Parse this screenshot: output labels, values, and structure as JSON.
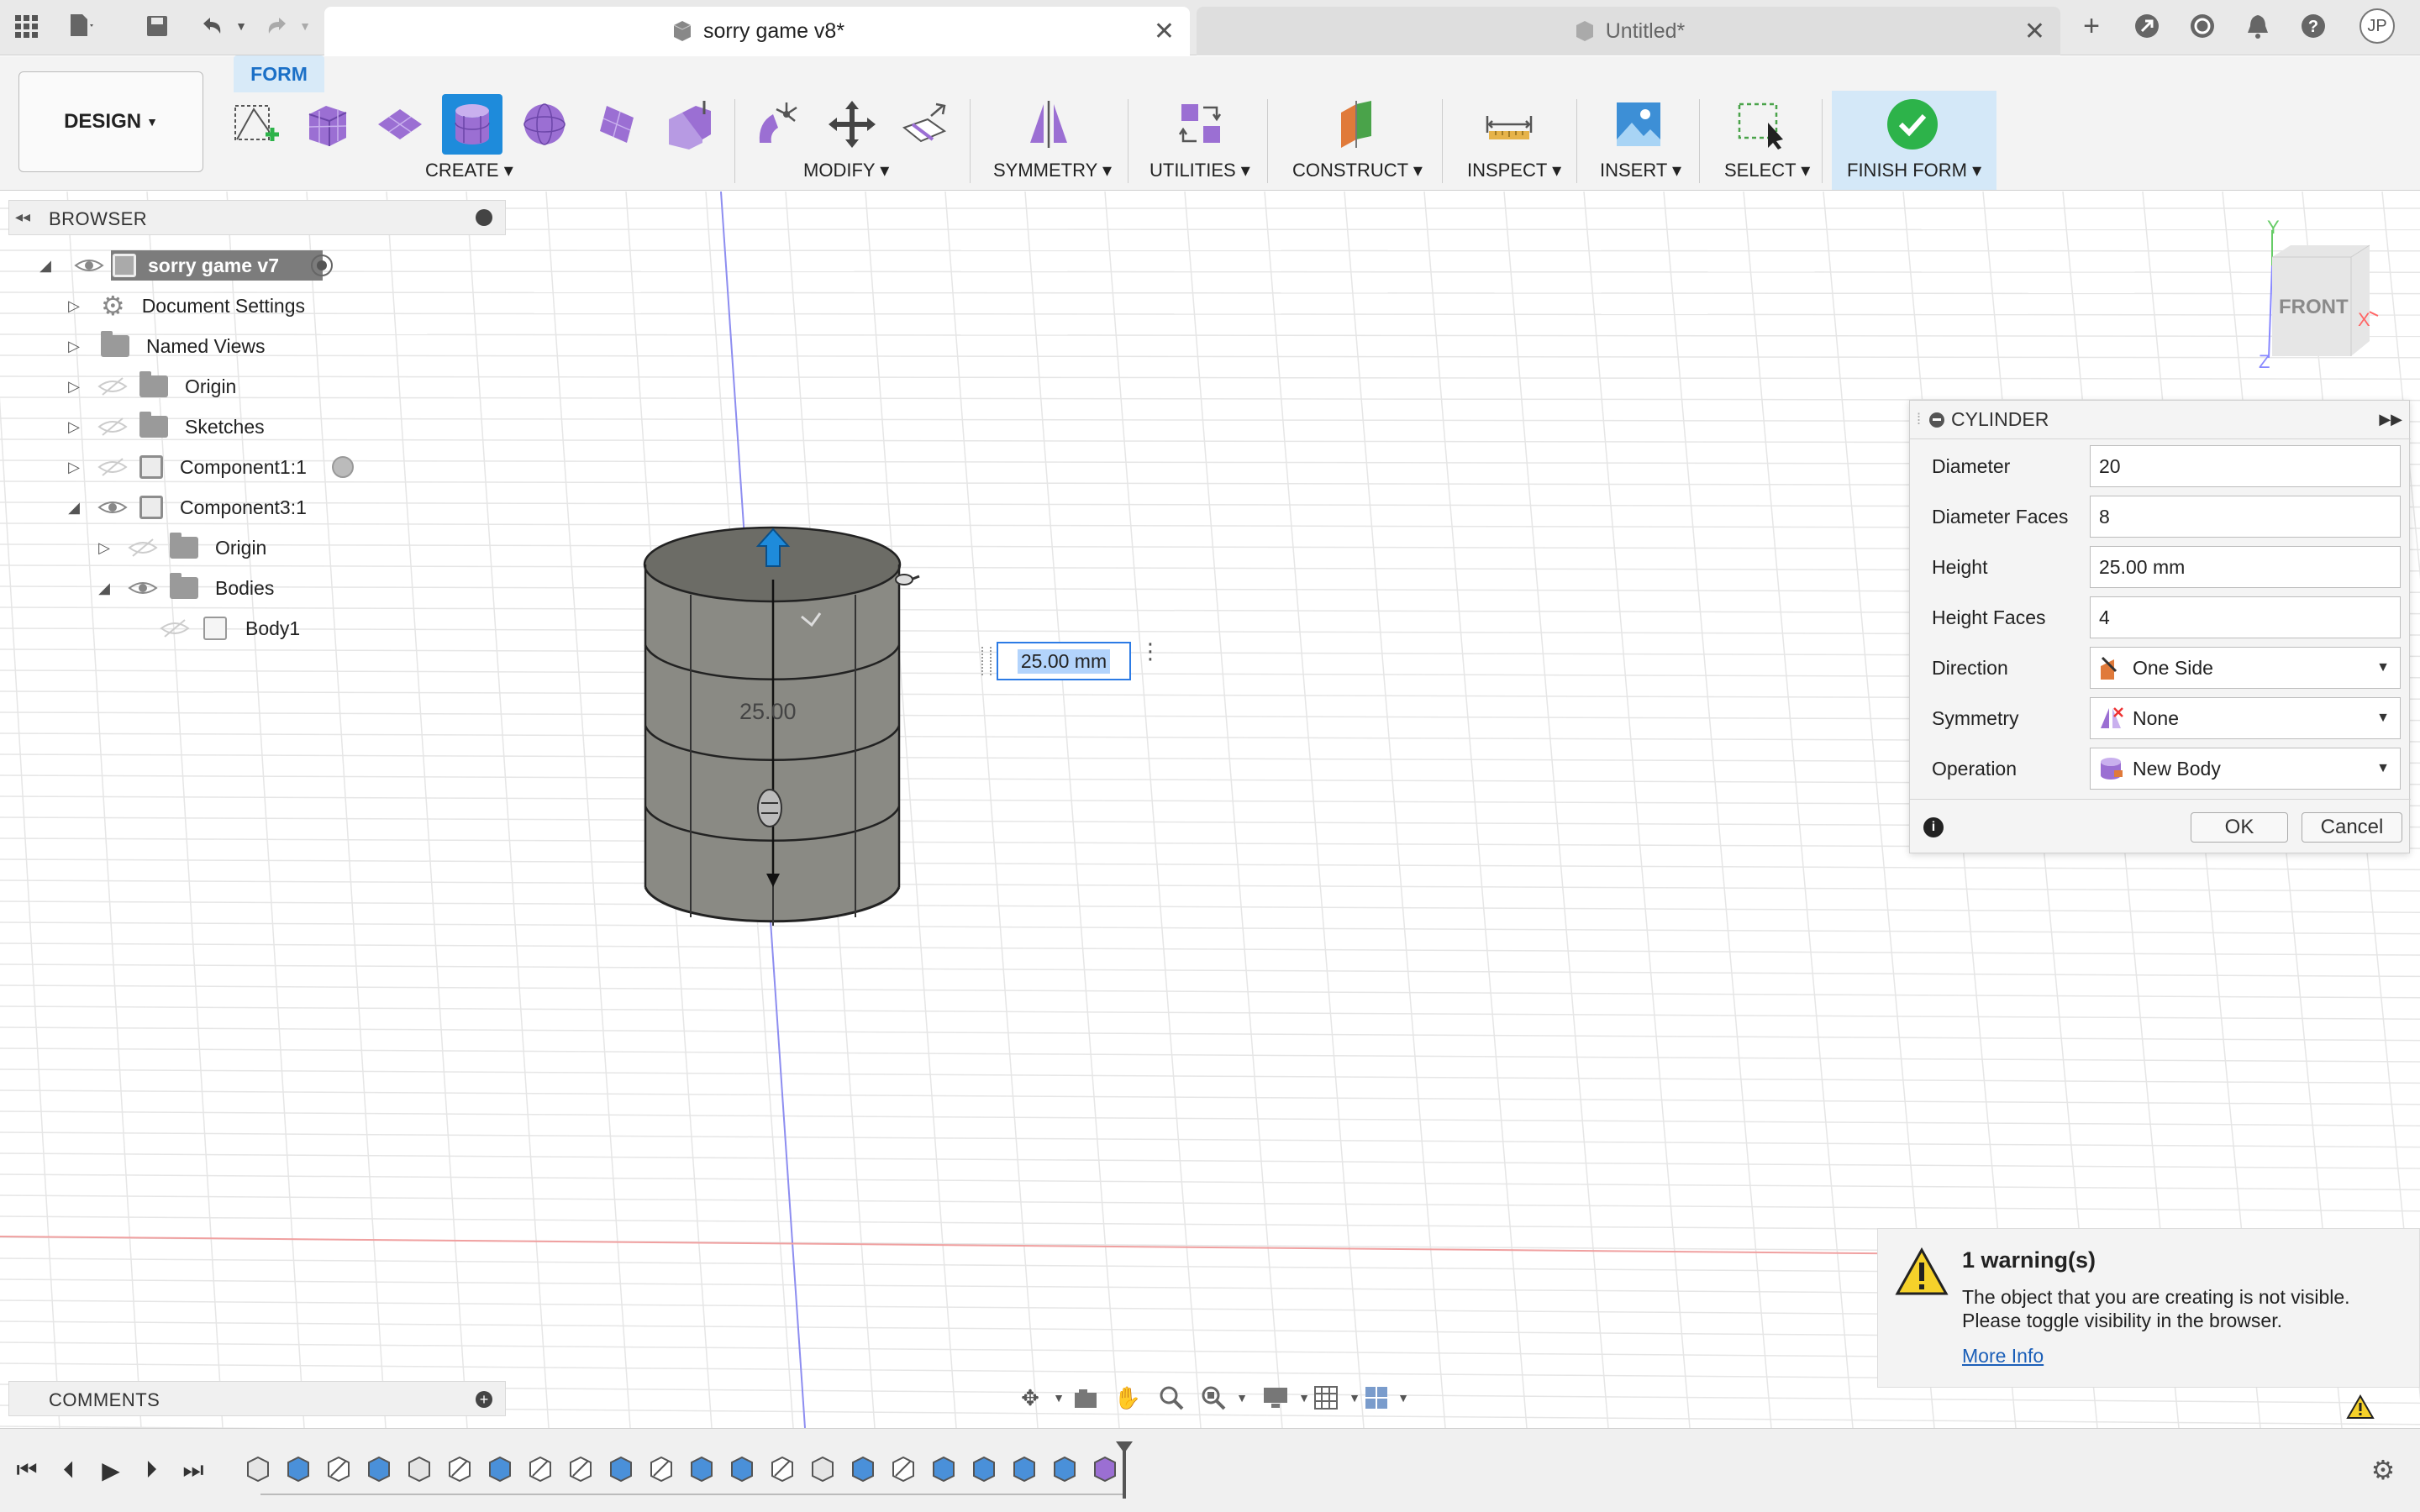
{
  "tabs": [
    {
      "label": "sorry game v8*",
      "active": true
    },
    {
      "label": "Untitled*",
      "active": false
    }
  ],
  "user_initials": "JP",
  "toolbar": {
    "workspace": "DESIGN",
    "active_tab": "FORM",
    "groups": {
      "create": "CREATE",
      "modify": "MODIFY",
      "symmetry": "SYMMETRY",
      "utilities": "UTILITIES",
      "construct": "CONSTRUCT",
      "inspect": "INSPECT",
      "insert": "INSERT",
      "select": "SELECT",
      "finish": "FINISH FORM"
    }
  },
  "browser": {
    "title": "BROWSER",
    "root": "sorry game v7",
    "items": [
      {
        "label": "Document Settings"
      },
      {
        "label": "Named Views"
      },
      {
        "label": "Origin"
      },
      {
        "label": "Sketches"
      },
      {
        "label": "Component1:1"
      },
      {
        "label": "Component3:1"
      },
      {
        "label": "Origin"
      },
      {
        "label": "Bodies"
      },
      {
        "label": "Body1"
      }
    ]
  },
  "comments": {
    "title": "COMMENTS"
  },
  "viewcube": {
    "face": "FRONT",
    "axis_y": "Y",
    "axis_x": "X",
    "axis_z": "Z"
  },
  "viewport": {
    "dimension_input": "25.00 mm",
    "model_label": "25.00"
  },
  "cylinder_dialog": {
    "title": "CYLINDER",
    "fields": {
      "diameter_label": "Diameter",
      "diameter_value": "20",
      "diameter_faces_label": "Diameter Faces",
      "diameter_faces_value": "8",
      "height_label": "Height",
      "height_value": "25.00 mm",
      "height_faces_label": "Height Faces",
      "height_faces_value": "4",
      "direction_label": "Direction",
      "direction_value": "One Side",
      "symmetry_label": "Symmetry",
      "symmetry_value": "None",
      "operation_label": "Operation",
      "operation_value": "New Body"
    },
    "ok_label": "OK",
    "cancel_label": "Cancel"
  },
  "warning": {
    "title": "1 warning(s)",
    "message_line1": "The object that you are creating is not visible.",
    "message_line2": "Please toggle visibility in the browser.",
    "link": "More Info"
  },
  "colors": {
    "accent": "#1e8bdb",
    "finish_check": "#2db34a",
    "form_purple": "#9b6fd3"
  }
}
